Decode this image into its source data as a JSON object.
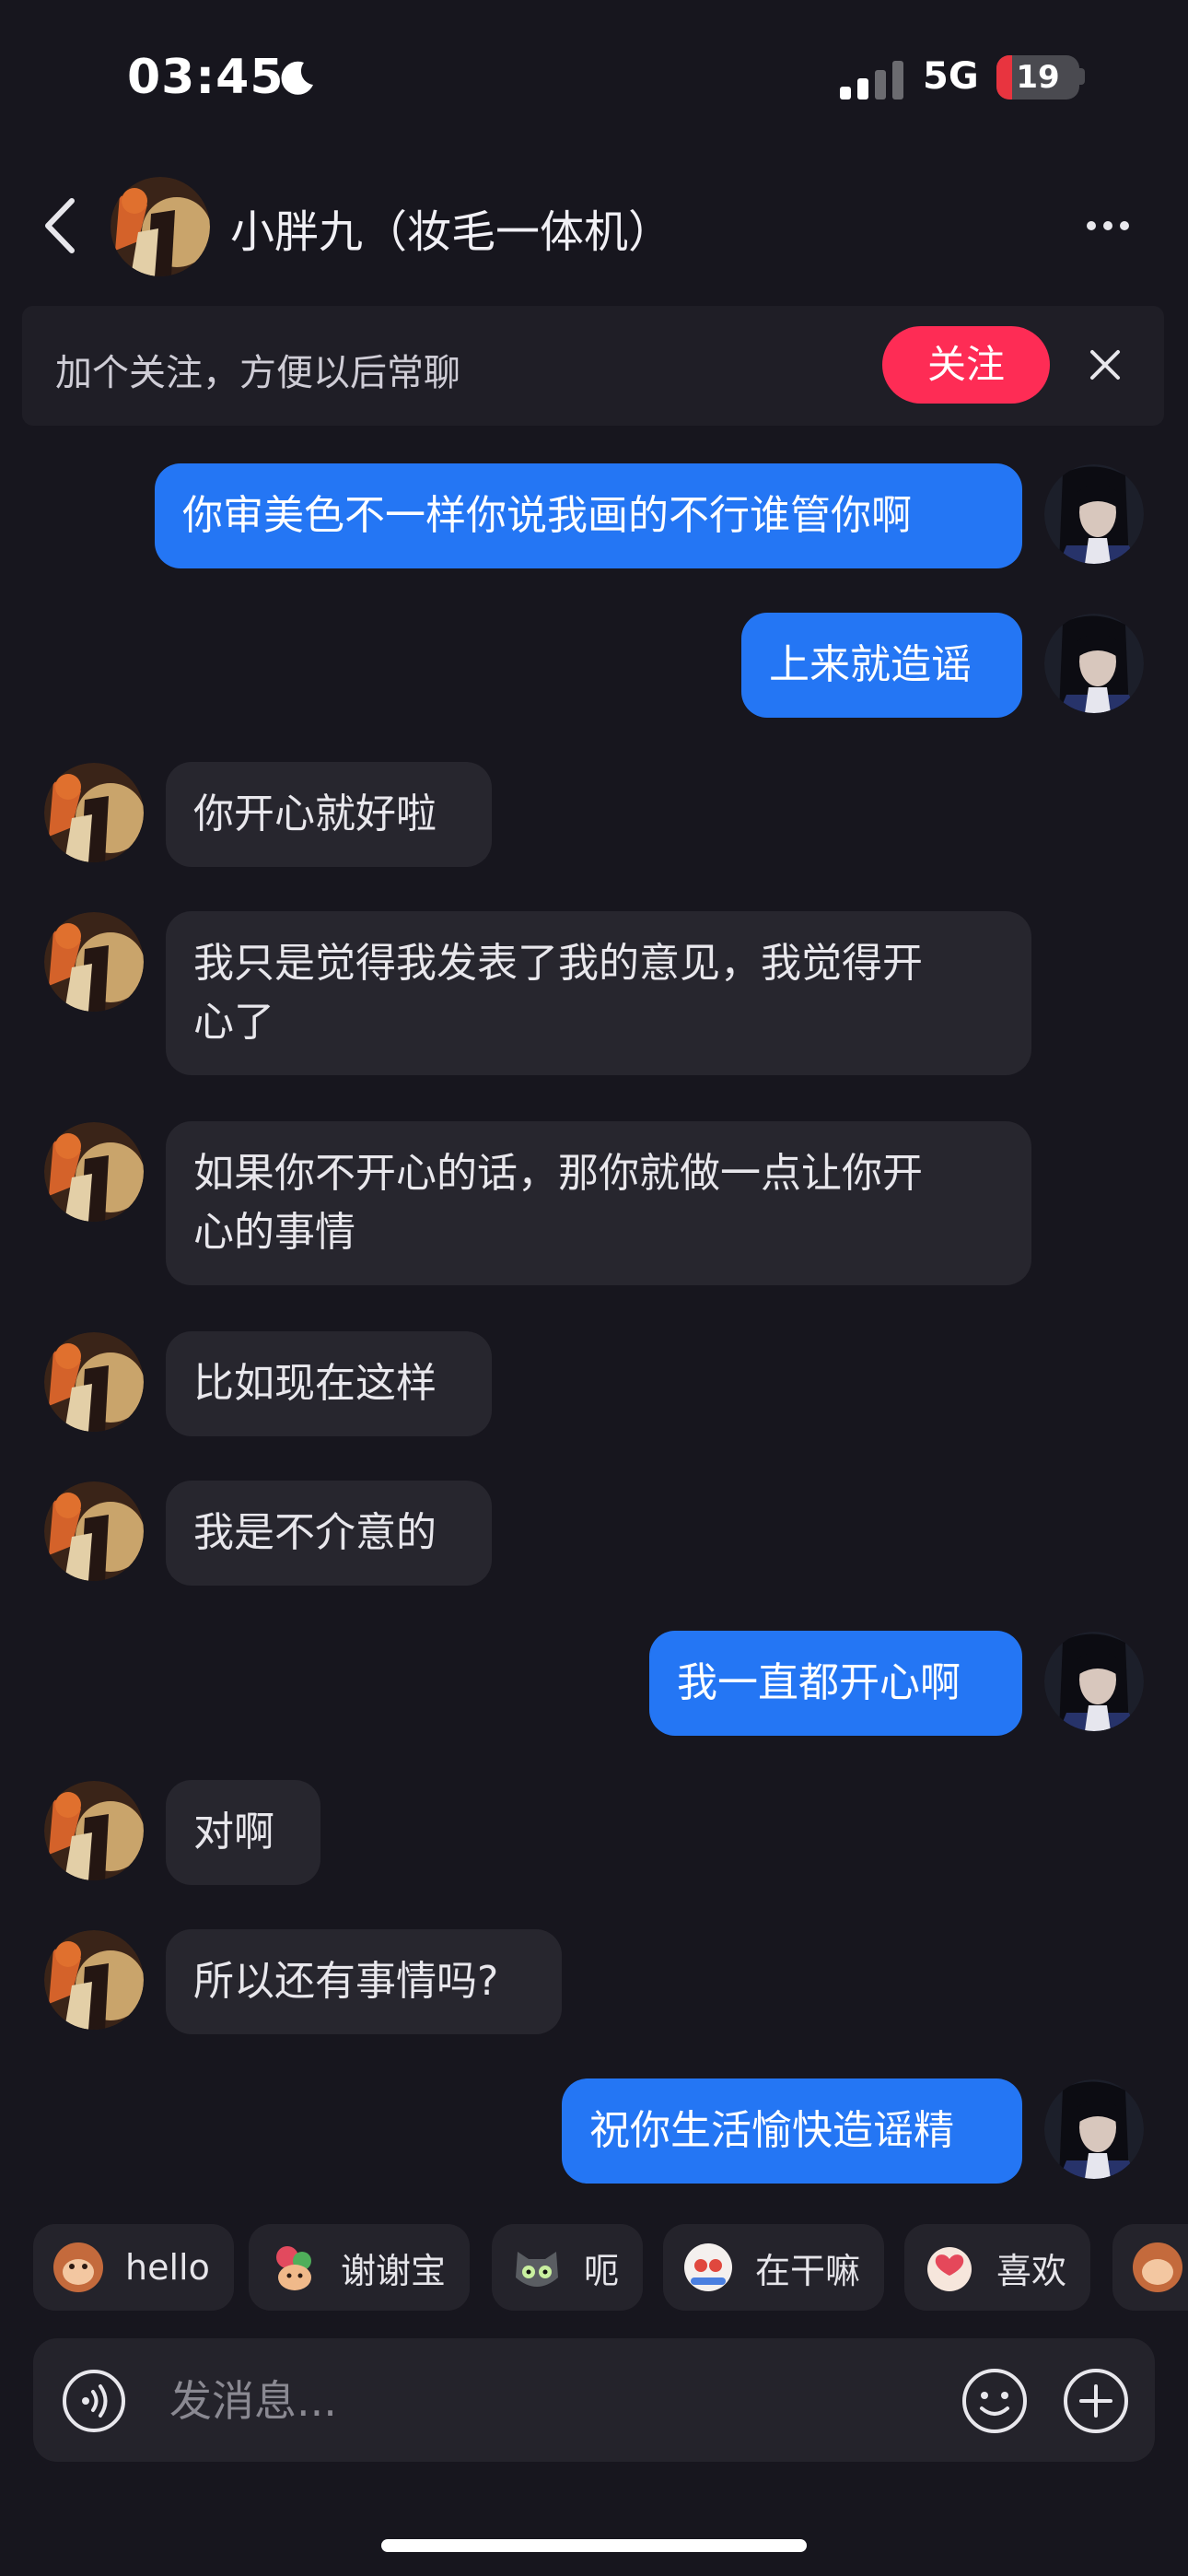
{
  "status_bar": {
    "time": "03:45",
    "network": "5G",
    "battery": "19",
    "battery_level": 0.19
  },
  "header": {
    "title": "小胖九（妆毛一体机）"
  },
  "follow_bar": {
    "text": "加个关注，方便以后常聊",
    "button": "关注"
  },
  "messages": [
    {
      "side": "out",
      "lines": [
        "你审美色不一样你说我画的不行谁管你啊"
      ]
    },
    {
      "side": "out",
      "lines": [
        "上来就造谣"
      ]
    },
    {
      "side": "in",
      "lines": [
        "你开心就好啦"
      ]
    },
    {
      "side": "in",
      "lines": [
        "我只是觉得我发表了我的意见，我觉得开",
        "心了"
      ]
    },
    {
      "side": "in",
      "lines": [
        "如果你不开心的话，那你就做一点让你开",
        "心的事情"
      ]
    },
    {
      "side": "in",
      "lines": [
        "比如现在这样"
      ]
    },
    {
      "side": "in",
      "lines": [
        "我是不介意的"
      ]
    },
    {
      "side": "out",
      "lines": [
        "我一直都开心啊"
      ]
    },
    {
      "side": "in",
      "lines": [
        "对啊"
      ]
    },
    {
      "side": "in",
      "lines": [
        "所以还有事情吗?"
      ]
    },
    {
      "side": "out",
      "lines": [
        "祝你生活愉快造谣精"
      ]
    }
  ],
  "quick_replies": [
    {
      "label": "hello",
      "icon": "monkey-emoji-icon"
    },
    {
      "label": "谢谢宝",
      "icon": "bouquet-emoji-icon"
    },
    {
      "label": "呃",
      "icon": "cat-emoji-icon"
    },
    {
      "label": "在干嘛",
      "icon": "peek-emoji-icon"
    },
    {
      "label": "喜欢",
      "icon": "love-emoji-icon"
    },
    {
      "label": "",
      "icon": "monkey-emoji-icon"
    }
  ],
  "input": {
    "placeholder": "发消息..."
  },
  "colors": {
    "background": "#17161e",
    "bubble_out": "#2476f4",
    "bubble_in": "#27262e",
    "follow_button": "#fe2c55"
  }
}
